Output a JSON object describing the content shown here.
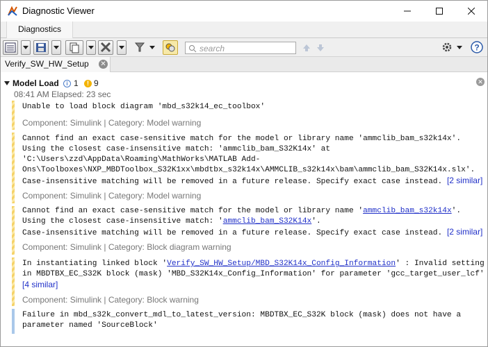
{
  "window": {
    "title": "Diagnostic Viewer"
  },
  "menu": {
    "tab_label": "Diagnostics"
  },
  "toolbar": {
    "search_placeholder": "search"
  },
  "doc_tab": {
    "label": "Verify_SW_HW_Setup"
  },
  "stage": {
    "name": "Model Load",
    "info_count": "1",
    "warn_count": "9",
    "time_line": "08:41 AM  Elapsed: 23 sec"
  },
  "messages": [
    {
      "line1": "Unable to load block diagram 'mbd_s32k14_ec_toolbox'",
      "component": "Component: Simulink | Category: Model warning"
    },
    {
      "line1": "Cannot find an exact case-sensitive match for the model or library name 'ammclib_bam_s32k14x'.",
      "line2": "Using the closest case-insensitive match: 'ammclib_bam_S32K14x' at",
      "line3": "'C:\\Users\\zzd\\AppData\\Roaming\\MathWorks\\MATLAB Add-",
      "line4": "Ons\\Toolboxes\\NXP_MBDToolbox_S32K1xx\\mbdtbx_s32k14x\\AMMCLIB_s32k14x\\bam\\ammclib_bam_S32K14x.slx'.",
      "line5": "Case-insensitive matching will be removed in a future release. Specify exact case instead.",
      "similar": "[2 similar]",
      "component": "Component: Simulink | Category: Model warning"
    },
    {
      "line1_pre": "Cannot find an exact case-sensitive match for the model or library name '",
      "line1_link": "ammclib_bam_s32k14x",
      "line1_post": "'.",
      "line2_pre": "Using the closest case-insensitive match: '",
      "line2_link": "ammclib_bam_S32K14x",
      "line2_post": "'.",
      "line3": "Case-insensitive matching will be removed in a future release. Specify exact case instead.",
      "similar": "[2 similar]",
      "component": "Component: Simulink | Category: Block diagram warning"
    },
    {
      "line1_pre": "In instantiating linked block '",
      "line1_link": "Verify_SW_HW_Setup/MBD_S32K14x_Config_Information",
      "line1_post": "' : Invalid setting",
      "line2": "in MBDTBX_EC_S32K block (mask) 'MBD_S32K14x_Config_Information' for parameter 'gcc_target_user_lcf'",
      "similar": "[4 similar]",
      "component": "Component: Simulink | Category: Block warning"
    },
    {
      "line1": "Failure in mbd_s32k_convert_mdl_to_latest_version: MBDTBX_EC_S32K block (mask) does not have a",
      "line2": "parameter named 'SourceBlock'"
    }
  ]
}
